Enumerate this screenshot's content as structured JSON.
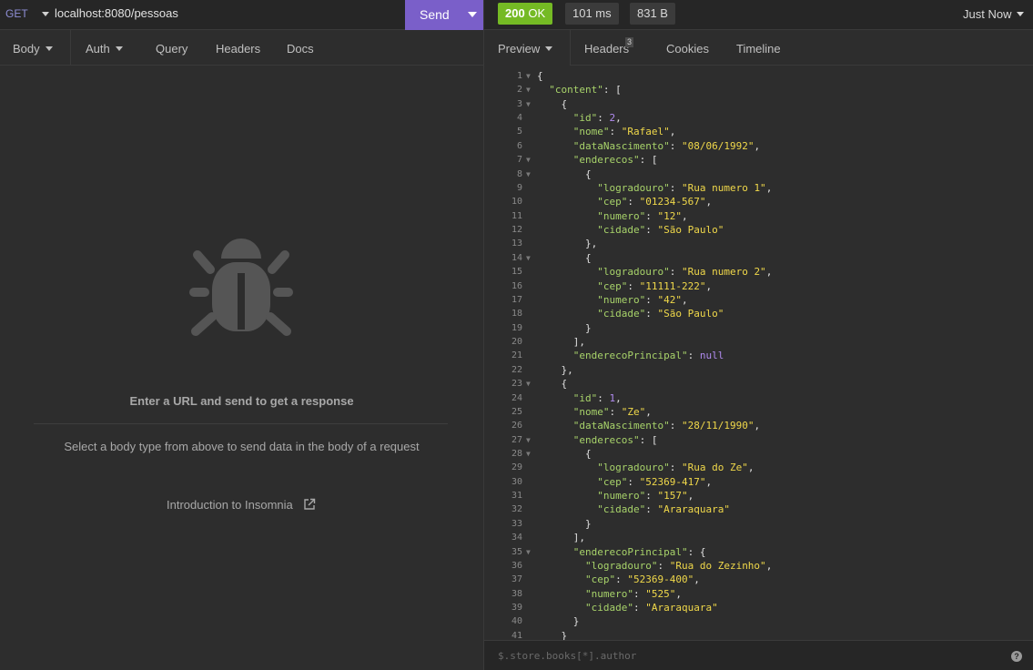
{
  "request": {
    "method": "GET",
    "url": "localhost:8080/pessoas",
    "send_label": "Send",
    "tabs": [
      "Body",
      "Auth",
      "Query",
      "Headers",
      "Docs"
    ]
  },
  "empty_state": {
    "title": "Enter a URL and send to get a response",
    "subtitle": "Select a body type from above to send data in the body of a request",
    "link": "Introduction to Insomnia"
  },
  "response": {
    "status_code": "200",
    "status_text": "OK",
    "time": "101 ms",
    "size": "831 B",
    "timestamp": "Just Now",
    "tabs": [
      "Preview",
      "Headers",
      "Cookies",
      "Timeline"
    ],
    "headers_count": "3",
    "filter_placeholder": "$.store.books[*].author",
    "help": "?",
    "code_lines": [
      [
        [
          "p",
          "{"
        ]
      ],
      [
        [
          "p",
          "  "
        ],
        [
          "k",
          "\"content\""
        ],
        [
          "p",
          ": ["
        ]
      ],
      [
        [
          "p",
          "    {"
        ]
      ],
      [
        [
          "p",
          "      "
        ],
        [
          "k",
          "\"id\""
        ],
        [
          "p",
          ": "
        ],
        [
          "n",
          "2"
        ],
        [
          "p",
          ","
        ]
      ],
      [
        [
          "p",
          "      "
        ],
        [
          "k",
          "\"nome\""
        ],
        [
          "p",
          ": "
        ],
        [
          "s",
          "\"Rafael\""
        ],
        [
          "p",
          ","
        ]
      ],
      [
        [
          "p",
          "      "
        ],
        [
          "k",
          "\"dataNascimento\""
        ],
        [
          "p",
          ": "
        ],
        [
          "s",
          "\"08/06/1992\""
        ],
        [
          "p",
          ","
        ]
      ],
      [
        [
          "p",
          "      "
        ],
        [
          "k",
          "\"enderecos\""
        ],
        [
          "p",
          ": ["
        ]
      ],
      [
        [
          "p",
          "        {"
        ]
      ],
      [
        [
          "p",
          "          "
        ],
        [
          "k",
          "\"logradouro\""
        ],
        [
          "p",
          ": "
        ],
        [
          "s",
          "\"Rua numero 1\""
        ],
        [
          "p",
          ","
        ]
      ],
      [
        [
          "p",
          "          "
        ],
        [
          "k",
          "\"cep\""
        ],
        [
          "p",
          ": "
        ],
        [
          "s",
          "\"01234-567\""
        ],
        [
          "p",
          ","
        ]
      ],
      [
        [
          "p",
          "          "
        ],
        [
          "k",
          "\"numero\""
        ],
        [
          "p",
          ": "
        ],
        [
          "s",
          "\"12\""
        ],
        [
          "p",
          ","
        ]
      ],
      [
        [
          "p",
          "          "
        ],
        [
          "k",
          "\"cidade\""
        ],
        [
          "p",
          ": "
        ],
        [
          "s",
          "\"São Paulo\""
        ]
      ],
      [
        [
          "p",
          "        },"
        ]
      ],
      [
        [
          "p",
          "        {"
        ]
      ],
      [
        [
          "p",
          "          "
        ],
        [
          "k",
          "\"logradouro\""
        ],
        [
          "p",
          ": "
        ],
        [
          "s",
          "\"Rua numero 2\""
        ],
        [
          "p",
          ","
        ]
      ],
      [
        [
          "p",
          "          "
        ],
        [
          "k",
          "\"cep\""
        ],
        [
          "p",
          ": "
        ],
        [
          "s",
          "\"11111-222\""
        ],
        [
          "p",
          ","
        ]
      ],
      [
        [
          "p",
          "          "
        ],
        [
          "k",
          "\"numero\""
        ],
        [
          "p",
          ": "
        ],
        [
          "s",
          "\"42\""
        ],
        [
          "p",
          ","
        ]
      ],
      [
        [
          "p",
          "          "
        ],
        [
          "k",
          "\"cidade\""
        ],
        [
          "p",
          ": "
        ],
        [
          "s",
          "\"São Paulo\""
        ]
      ],
      [
        [
          "p",
          "        }"
        ]
      ],
      [
        [
          "p",
          "      ],"
        ]
      ],
      [
        [
          "p",
          "      "
        ],
        [
          "k",
          "\"enderecoPrincipal\""
        ],
        [
          "p",
          ": "
        ],
        [
          "nl",
          "null"
        ]
      ],
      [
        [
          "p",
          "    },"
        ]
      ],
      [
        [
          "p",
          "    {"
        ]
      ],
      [
        [
          "p",
          "      "
        ],
        [
          "k",
          "\"id\""
        ],
        [
          "p",
          ": "
        ],
        [
          "n",
          "1"
        ],
        [
          "p",
          ","
        ]
      ],
      [
        [
          "p",
          "      "
        ],
        [
          "k",
          "\"nome\""
        ],
        [
          "p",
          ": "
        ],
        [
          "s",
          "\"Ze\""
        ],
        [
          "p",
          ","
        ]
      ],
      [
        [
          "p",
          "      "
        ],
        [
          "k",
          "\"dataNascimento\""
        ],
        [
          "p",
          ": "
        ],
        [
          "s",
          "\"28/11/1990\""
        ],
        [
          "p",
          ","
        ]
      ],
      [
        [
          "p",
          "      "
        ],
        [
          "k",
          "\"enderecos\""
        ],
        [
          "p",
          ": ["
        ]
      ],
      [
        [
          "p",
          "        {"
        ]
      ],
      [
        [
          "p",
          "          "
        ],
        [
          "k",
          "\"logradouro\""
        ],
        [
          "p",
          ": "
        ],
        [
          "s",
          "\"Rua do Ze\""
        ],
        [
          "p",
          ","
        ]
      ],
      [
        [
          "p",
          "          "
        ],
        [
          "k",
          "\"cep\""
        ],
        [
          "p",
          ": "
        ],
        [
          "s",
          "\"52369-417\""
        ],
        [
          "p",
          ","
        ]
      ],
      [
        [
          "p",
          "          "
        ],
        [
          "k",
          "\"numero\""
        ],
        [
          "p",
          ": "
        ],
        [
          "s",
          "\"157\""
        ],
        [
          "p",
          ","
        ]
      ],
      [
        [
          "p",
          "          "
        ],
        [
          "k",
          "\"cidade\""
        ],
        [
          "p",
          ": "
        ],
        [
          "s",
          "\"Araraquara\""
        ]
      ],
      [
        [
          "p",
          "        }"
        ]
      ],
      [
        [
          "p",
          "      ],"
        ]
      ],
      [
        [
          "p",
          "      "
        ],
        [
          "k",
          "\"enderecoPrincipal\""
        ],
        [
          "p",
          ": {"
        ]
      ],
      [
        [
          "p",
          "        "
        ],
        [
          "k",
          "\"logradouro\""
        ],
        [
          "p",
          ": "
        ],
        [
          "s",
          "\"Rua do Zezinho\""
        ],
        [
          "p",
          ","
        ]
      ],
      [
        [
          "p",
          "        "
        ],
        [
          "k",
          "\"cep\""
        ],
        [
          "p",
          ": "
        ],
        [
          "s",
          "\"52369-400\""
        ],
        [
          "p",
          ","
        ]
      ],
      [
        [
          "p",
          "        "
        ],
        [
          "k",
          "\"numero\""
        ],
        [
          "p",
          ": "
        ],
        [
          "s",
          "\"525\""
        ],
        [
          "p",
          ","
        ]
      ],
      [
        [
          "p",
          "        "
        ],
        [
          "k",
          "\"cidade\""
        ],
        [
          "p",
          ": "
        ],
        [
          "s",
          "\"Araraquara\""
        ]
      ],
      [
        [
          "p",
          "      }"
        ]
      ],
      [
        [
          "p",
          "    }"
        ]
      ]
    ],
    "fold_lines": [
      1,
      2,
      3,
      7,
      8,
      14,
      23,
      27,
      28,
      35
    ]
  },
  "colors": {
    "status_ok": "#75ba24",
    "send_button": "#7a5fc9",
    "json_key": "#a8d36a",
    "json_string": "#f0d84a",
    "json_number": "#b18bf0"
  }
}
